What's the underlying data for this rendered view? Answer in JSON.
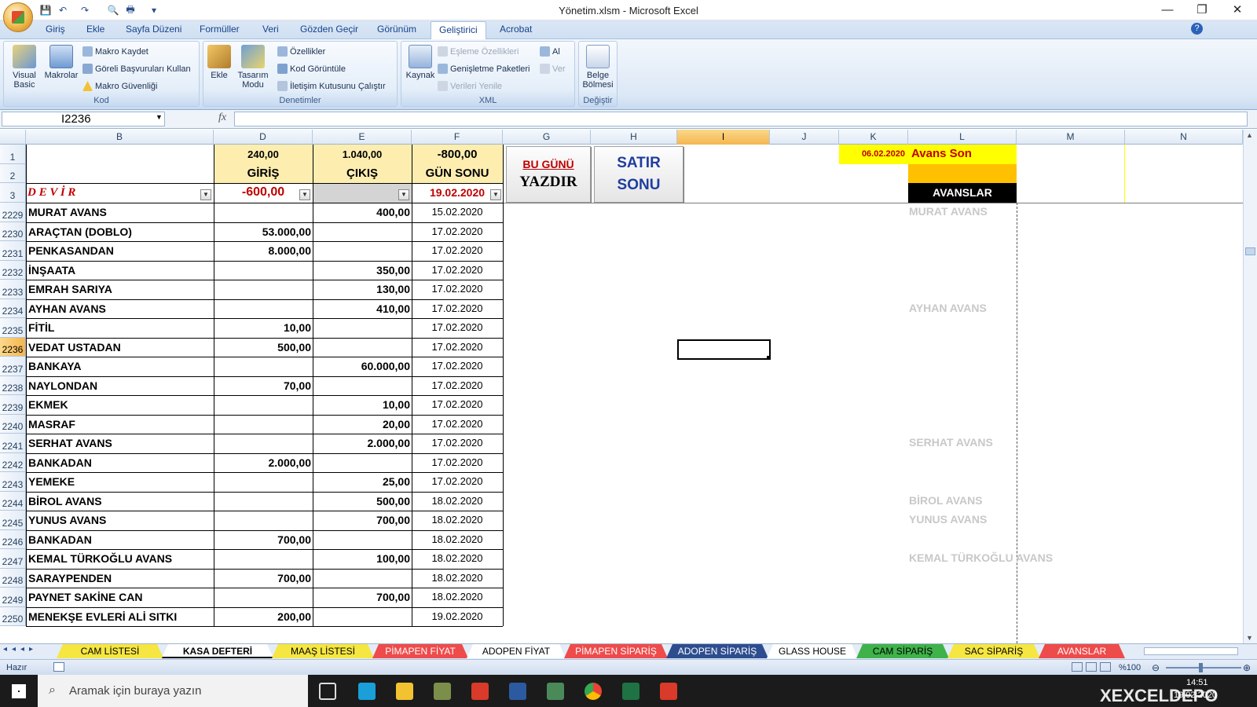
{
  "window": {
    "title": "Yönetim.xlsm - Microsoft Excel",
    "minimize": "—",
    "maximize": "❐",
    "close": "✕"
  },
  "qat": {
    "save": "💾",
    "undo": "↶",
    "redo": "↷",
    "print_preview": "🔍",
    "print": "🖶",
    "more": "▾"
  },
  "menu": {
    "tabs": [
      "Giriş",
      "Ekle",
      "Sayfa Düzeni",
      "Formüller",
      "Veri",
      "Gözden Geçir",
      "Görünüm",
      "Geliştirici",
      "Acrobat"
    ],
    "active_tab": "Geliştirici",
    "help": "?"
  },
  "ribbon": {
    "kod": {
      "label": "Kod",
      "visual_basic": "Visual Basic",
      "makrolar": "Makrolar",
      "makro_kaydet": "Makro Kaydet",
      "goreli": "Göreli Başvuruları Kullan",
      "guvenlik": "Makro Güvenliği"
    },
    "denetimler": {
      "label": "Denetimler",
      "ekle": "Ekle",
      "tasarim": "Tasarım Modu",
      "ozellikler": "Özellikler",
      "kod_goruntule": "Kod Görüntüle",
      "iletisim": "İletişim Kutusunu Çalıştır"
    },
    "xml": {
      "label": "XML",
      "kaynak": "Kaynak",
      "esleme": "Eşleme Özellikleri",
      "genisletme": "Genişletme Paketleri",
      "verileri_yenile": "Verileri Yenile",
      "al": "Al",
      "ver": "Ver"
    },
    "degistir": {
      "label": "Değiştir",
      "belge_bolmesi": "Belge Bölmesi"
    }
  },
  "formula_bar": {
    "name_box": "I2236",
    "fx": "fx",
    "formula": ""
  },
  "columns": [
    "B",
    "D",
    "E",
    "F",
    "G",
    "H",
    "I",
    "J",
    "K",
    "L",
    "M",
    "N"
  ],
  "selected_column": "I",
  "header_rows": [
    "1",
    "2",
    "3"
  ],
  "summary": {
    "giris_total": "240,00",
    "giris_label": "GİRİŞ",
    "cikis_total": "1.040,00",
    "cikis_label": "ÇIKIŞ",
    "gunsonu_total": "-800,00",
    "gunsonu_label": "GÜN SONU",
    "devir_label": "D E V İ R",
    "devir_value": "-600,00",
    "current_date": "19.02.2020"
  },
  "buttons": {
    "bugunu": "BU GÜNÜ",
    "yazdir": "YAZDIR",
    "satir": "SATIR",
    "sonu": "SONU"
  },
  "avans_panel": {
    "date": "06.02.2020",
    "title": "Avans Son",
    "header": "AVANSLAR"
  },
  "rows": [
    {
      "n": "2229",
      "name": "MURAT AVANS",
      "giris": "",
      "cikis": "400,00",
      "date": "15.02.2020"
    },
    {
      "n": "2230",
      "name": "ARAÇTAN (DOBLO)",
      "giris": "53.000,00",
      "cikis": "",
      "date": "17.02.2020"
    },
    {
      "n": "2231",
      "name": "PENKASANDAN",
      "giris": "8.000,00",
      "cikis": "",
      "date": "17.02.2020"
    },
    {
      "n": "2232",
      "name": "İNŞAATA",
      "giris": "",
      "cikis": "350,00",
      "date": "17.02.2020"
    },
    {
      "n": "2233",
      "name": "EMRAH SARIYA",
      "giris": "",
      "cikis": "130,00",
      "date": "17.02.2020"
    },
    {
      "n": "2234",
      "name": "AYHAN AVANS",
      "giris": "",
      "cikis": "410,00",
      "date": "17.02.2020"
    },
    {
      "n": "2235",
      "name": "FİTİL",
      "giris": "10,00",
      "cikis": "",
      "date": "17.02.2020"
    },
    {
      "n": "2236",
      "name": "VEDAT USTADAN",
      "giris": "500,00",
      "cikis": "",
      "date": "17.02.2020"
    },
    {
      "n": "2237",
      "name": "BANKAYA",
      "giris": "",
      "cikis": "60.000,00",
      "date": "17.02.2020"
    },
    {
      "n": "2238",
      "name": "NAYLONDAN",
      "giris": "70,00",
      "cikis": "",
      "date": "17.02.2020"
    },
    {
      "n": "2239",
      "name": "EKMEK",
      "giris": "",
      "cikis": "10,00",
      "date": "17.02.2020"
    },
    {
      "n": "2240",
      "name": "MASRAF",
      "giris": "",
      "cikis": "20,00",
      "date": "17.02.2020"
    },
    {
      "n": "2241",
      "name": "SERHAT AVANS",
      "giris": "",
      "cikis": "2.000,00",
      "date": "17.02.2020"
    },
    {
      "n": "2242",
      "name": "BANKADAN",
      "giris": "2.000,00",
      "cikis": "",
      "date": "17.02.2020"
    },
    {
      "n": "2243",
      "name": "YEMEKE",
      "giris": "",
      "cikis": "25,00",
      "date": "17.02.2020"
    },
    {
      "n": "2244",
      "name": "BİROL AVANS",
      "giris": "",
      "cikis": "500,00",
      "date": "18.02.2020"
    },
    {
      "n": "2245",
      "name": "YUNUS AVANS",
      "giris": "",
      "cikis": "700,00",
      "date": "18.02.2020"
    },
    {
      "n": "2246",
      "name": "BANKADAN",
      "giris": "700,00",
      "cikis": "",
      "date": "18.02.2020"
    },
    {
      "n": "2247",
      "name": "KEMAL TÜRKOĞLU AVANS",
      "giris": "",
      "cikis": "100,00",
      "date": "18.02.2020"
    },
    {
      "n": "2248",
      "name": "SARAYPENDEN",
      "giris": "700,00",
      "cikis": "",
      "date": "18.02.2020"
    },
    {
      "n": "2249",
      "name": "PAYNET SAKİNE CAN",
      "giris": "",
      "cikis": "700,00",
      "date": "18.02.2020"
    },
    {
      "n": "2250",
      "name": "MENEKŞE EVLERİ ALİ SITKI",
      "giris": "200,00",
      "cikis": "",
      "date": "19.02.2020"
    }
  ],
  "selected_row": "2236",
  "avans_names": [
    {
      "row": 0,
      "text": "MURAT AVANS"
    },
    {
      "row": 5,
      "text": "AYHAN AVANS"
    },
    {
      "row": 12,
      "text": "SERHAT AVANS"
    },
    {
      "row": 15,
      "text": "BİROL AVANS"
    },
    {
      "row": 16,
      "text": "YUNUS AVANS"
    },
    {
      "row": 18,
      "text": "KEMAL TÜRKOĞLU AVANS"
    }
  ],
  "sheet_tabs": [
    {
      "label": "CAM LİSTESİ",
      "color": "#f5e642",
      "text": "#000"
    },
    {
      "label": "KASA DEFTERİ",
      "color": "#ffffff",
      "text": "#000",
      "active": true
    },
    {
      "label": "MAAŞ LİSTESİ",
      "color": "#f5e642",
      "text": "#000"
    },
    {
      "label": "PİMAPEN FİYAT",
      "color": "#ee4b4b",
      "text": "#fff"
    },
    {
      "label": "ADOPEN FİYAT",
      "color": "#ffffff",
      "text": "#000"
    },
    {
      "label": "PİMAPEN SİPARİŞ",
      "color": "#ee4b4b",
      "text": "#fff"
    },
    {
      "label": "ADOPEN SİPARİŞ",
      "color": "#2e4d8f",
      "text": "#fff"
    },
    {
      "label": "GLASS HOUSE",
      "color": "#ffffff",
      "text": "#000"
    },
    {
      "label": "CAM SİPARİŞ",
      "color": "#3fb34a",
      "text": "#000"
    },
    {
      "label": "SAC SİPARİŞ",
      "color": "#f5e642",
      "text": "#000"
    },
    {
      "label": "AVANSLAR",
      "color": "#ee4b4b",
      "text": "#fff"
    }
  ],
  "status": {
    "ready": "Hazır",
    "zoom": "%100"
  },
  "taskbar": {
    "search_placeholder": "Aramak için buraya yazın",
    "time": "14:51",
    "date": "19.02.2020",
    "watermark": "XEXCELDEPO"
  },
  "colors": {
    "accent_yellow": "#fdeeb0",
    "bright_yellow": "#ffff00",
    "orange": "#ffc000",
    "red": "#c00000",
    "blue": "#1f3da0",
    "gray_text": "#c8c8c8"
  }
}
